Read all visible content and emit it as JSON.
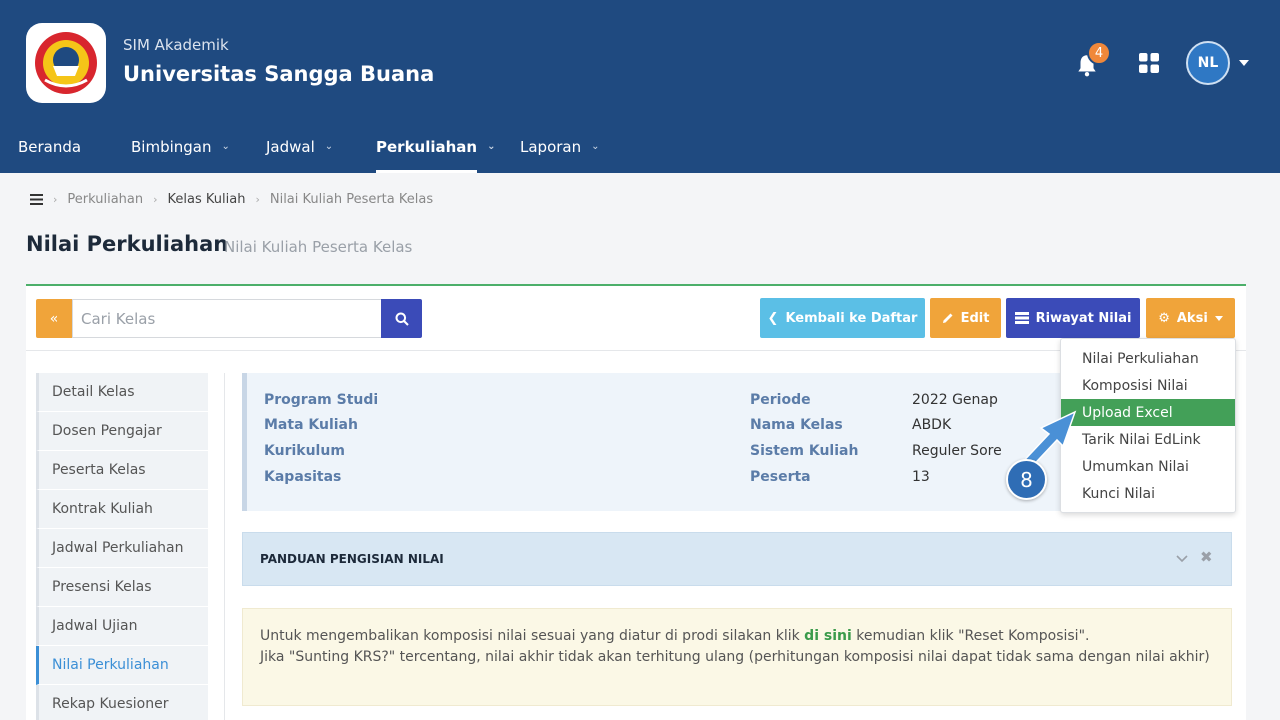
{
  "header": {
    "app_subtitle": "SIM Akademik",
    "app_title": "Universitas Sangga Buana",
    "notification_count": "4",
    "user_initials": "NL"
  },
  "nav": [
    {
      "label": "Beranda",
      "dropdown": false,
      "active": false
    },
    {
      "label": "Bimbingan",
      "dropdown": true,
      "active": false
    },
    {
      "label": "Jadwal",
      "dropdown": true,
      "active": false
    },
    {
      "label": "Perkuliahan",
      "dropdown": true,
      "active": true
    },
    {
      "label": "Laporan",
      "dropdown": true,
      "active": false
    }
  ],
  "breadcrumb": [
    "Perkuliahan",
    "Kelas Kuliah",
    "Nilai Kuliah Peserta Kelas"
  ],
  "page": {
    "title": "Nilai Perkuliahan",
    "subtitle": "Nilai Kuliah Peserta Kelas"
  },
  "toolbar": {
    "search_placeholder": "Cari Kelas",
    "back_label": "Kembali ke Daftar",
    "edit_label": "Edit",
    "riwayat_label": "Riwayat Nilai",
    "aksi_label": "Aksi"
  },
  "sidebar": [
    {
      "label": "Detail Kelas",
      "active": false
    },
    {
      "label": "Dosen Pengajar",
      "active": false
    },
    {
      "label": "Peserta Kelas",
      "active": false
    },
    {
      "label": "Kontrak Kuliah",
      "active": false
    },
    {
      "label": "Jadwal Perkuliahan",
      "active": false
    },
    {
      "label": "Presensi Kelas",
      "active": false
    },
    {
      "label": "Jadwal Ujian",
      "active": false
    },
    {
      "label": "Nilai Perkuliahan",
      "active": true
    },
    {
      "label": "Rekap Kuesioner",
      "active": false
    }
  ],
  "info": {
    "left": [
      {
        "label": "Program Studi",
        "value": ""
      },
      {
        "label": "Mata Kuliah",
        "value": ""
      },
      {
        "label": "Kurikulum",
        "value": ""
      },
      {
        "label": "Kapasitas",
        "value": ""
      }
    ],
    "right": [
      {
        "label": "Periode",
        "value": "2022 Genap"
      },
      {
        "label": "Nama Kelas",
        "value": "ABDK"
      },
      {
        "label": "Sistem Kuliah",
        "value": "Reguler Sore"
      },
      {
        "label": "Peserta",
        "value": "13"
      }
    ]
  },
  "panduan": {
    "title": "PANDUAN PENGISIAN NILAI"
  },
  "note": {
    "line1_before": "Untuk mengembalikan komposisi nilai sesuai yang diatur di prodi silakan klik ",
    "line1_link": "di sini",
    "line1_after": " kemudian klik \"Reset Komposisi\".",
    "line2": "Jika \"Sunting KRS?\" tercentang, nilai akhir tidak akan terhitung ulang (perhitungan komposisi nilai dapat tidak sama dengan nilai akhir)"
  },
  "aksi_menu": [
    {
      "label": "Nilai Perkuliahan",
      "highlighted": false
    },
    {
      "label": "Komposisi Nilai",
      "highlighted": false
    },
    {
      "label": "Upload Excel",
      "highlighted": true
    },
    {
      "label": "Tarik Nilai EdLink",
      "highlighted": false
    },
    {
      "label": "Umumkan Nilai",
      "highlighted": false
    },
    {
      "label": "Kunci Nilai",
      "highlighted": false
    }
  ],
  "annotation": {
    "step_number": "8"
  },
  "colors": {
    "header_bg": "#1f4a80",
    "accent_green": "#43a058",
    "warning_orange": "#f0a43a",
    "primary_indigo": "#3b4bb8",
    "info_cyan": "#5bbfe6"
  }
}
